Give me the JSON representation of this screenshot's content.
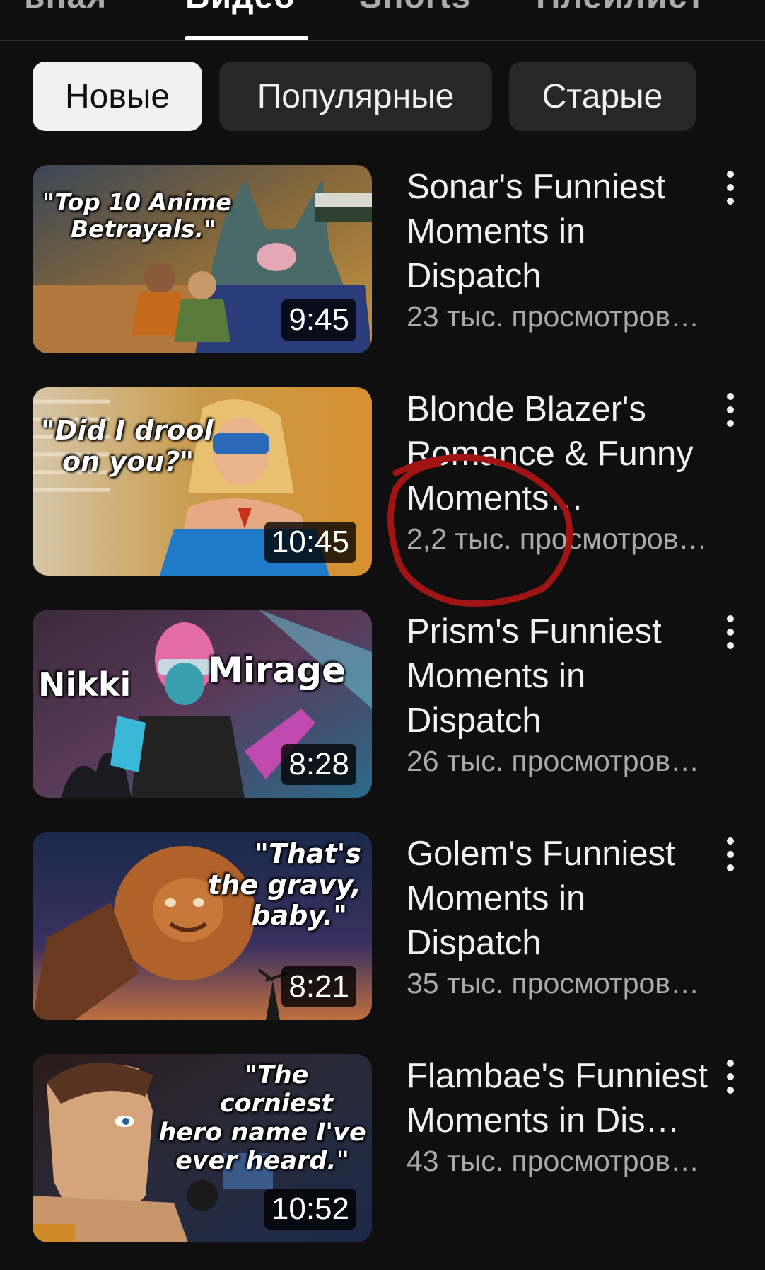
{
  "tabs": {
    "items": [
      {
        "label": "ьная"
      },
      {
        "label": "Видео"
      },
      {
        "label": "Shorts"
      },
      {
        "label": "Плейлист"
      }
    ]
  },
  "chips": [
    {
      "label": "Новые"
    },
    {
      "label": "Популярные"
    },
    {
      "label": "Старые"
    }
  ],
  "videos": [
    {
      "title": "Sonar's Funniest Moments in Dispatch",
      "views": "23 тыс. просмотров…",
      "duration": "9:45",
      "thumb_text": [
        "\"Top 10 Anime",
        "Betrayals.\""
      ]
    },
    {
      "title": "Blonde Blazer's Romance & Funny Moments…",
      "views": "2,2 тыс. просмотров…",
      "duration": "10:45",
      "thumb_text": [
        "\"Did I drool",
        "on you?\""
      ]
    },
    {
      "title": "Prism's Funniest Moments in Dispatch",
      "views": "26 тыс. просмотров…",
      "duration": "8:28",
      "thumb_text": [
        "Nikki",
        "Mirage"
      ]
    },
    {
      "title": "Golem's Funniest Moments in Dispatch",
      "views": "35 тыс. просмотров…",
      "duration": "8:21",
      "thumb_text": [
        "\"That's",
        "the gravy,",
        "baby.\""
      ]
    },
    {
      "title": "Flambae's Funniest Moments in Dis…",
      "views": "43 тыс. просмотров…",
      "duration": "10:52",
      "thumb_text": [
        "\"The corniest",
        "hero name I've",
        "ever heard.\""
      ]
    }
  ],
  "colors": {
    "background": "#0f0f0f",
    "chip": "#272727",
    "chip_selected": "#f1f1f1",
    "annotation": "#a01414"
  },
  "icons": {
    "more": "kebab-menu-icon"
  }
}
